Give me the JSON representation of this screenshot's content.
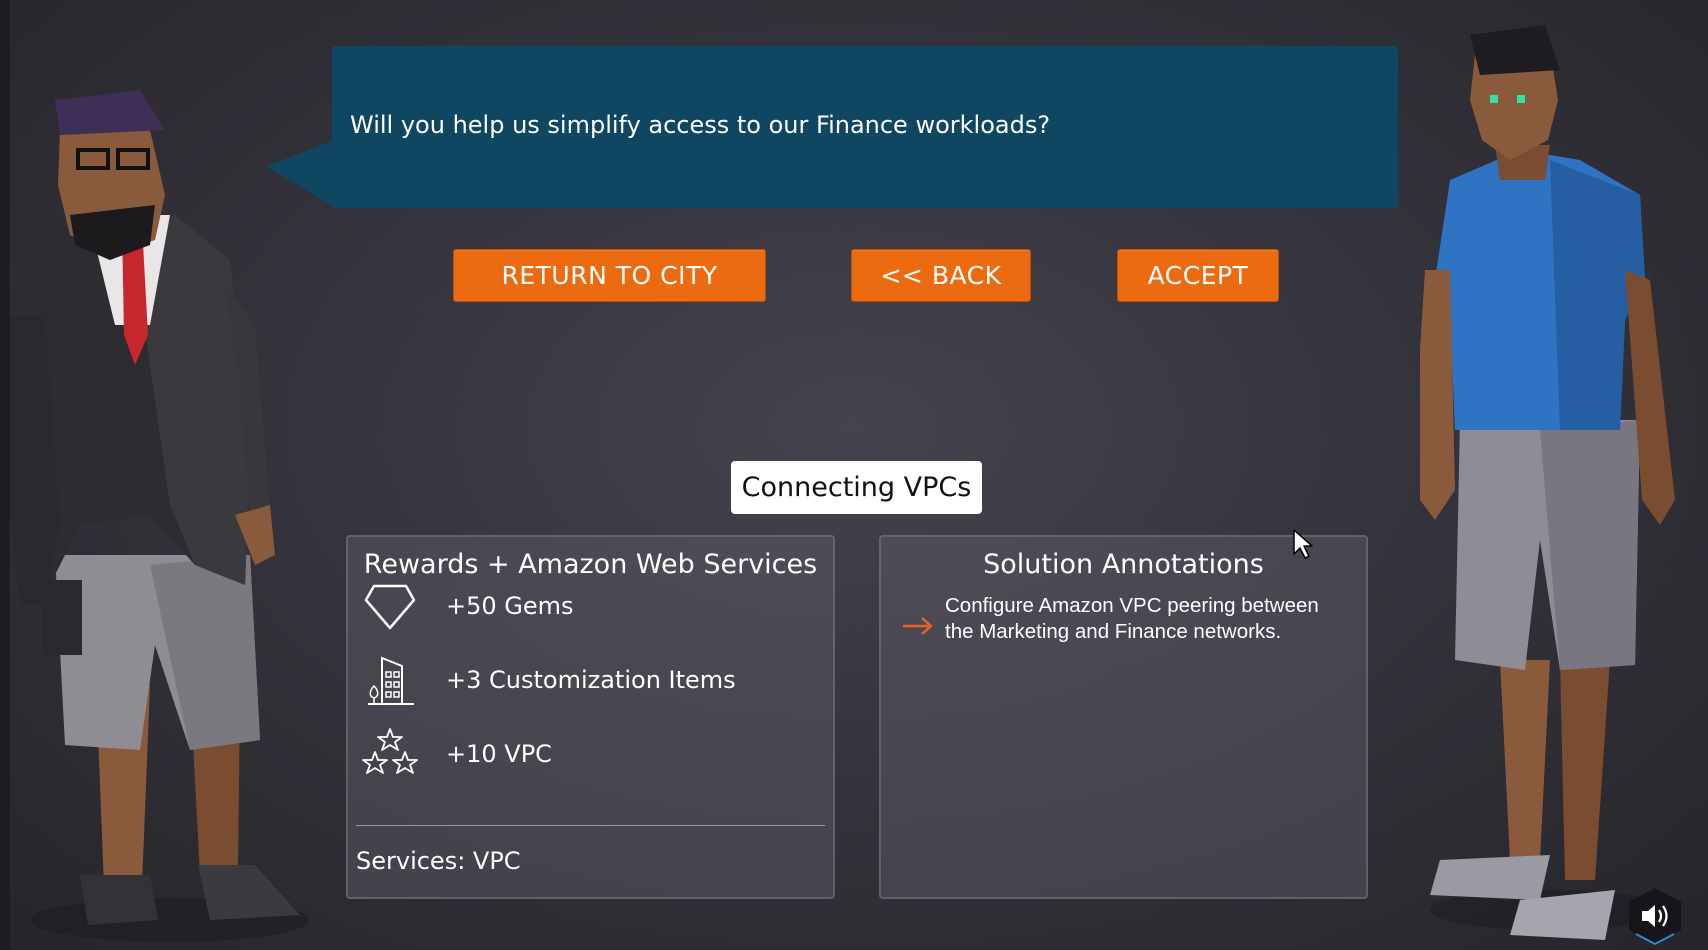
{
  "dialogue": {
    "text": "Will you help us simplify access to our Finance workloads?"
  },
  "buttons": {
    "return_to_city": "RETURN TO CITY",
    "back": "<< BACK",
    "accept": "ACCEPT"
  },
  "quest": {
    "title": "Connecting VPCs"
  },
  "rewards": {
    "heading": "Rewards + Amazon Web Services",
    "items": [
      {
        "icon": "gem-icon",
        "label": "+50 Gems"
      },
      {
        "icon": "building-icon",
        "label": "+3 Customization Items"
      },
      {
        "icon": "stars-icon",
        "label": "+10 VPC"
      }
    ],
    "services": "Services: VPC"
  },
  "solution": {
    "heading": "Solution Annotations",
    "annotation": "Configure Amazon VPC peering between the Marketing and Finance networks."
  },
  "colors": {
    "bubble": "#0f4662",
    "button": "#ec6a10",
    "arrow": "#e8622a"
  },
  "controls": {
    "sound_icon": "speaker-icon"
  }
}
